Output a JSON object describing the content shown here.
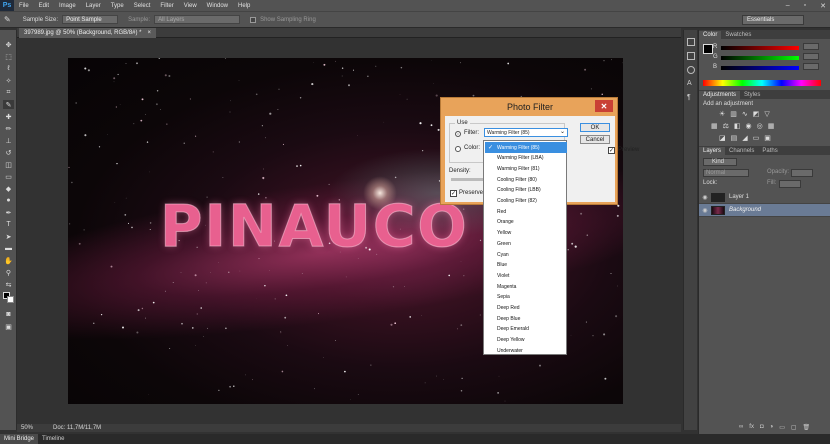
{
  "app": {
    "logo": "Ps"
  },
  "menubar": {
    "items": [
      "File",
      "Edit",
      "Image",
      "Layer",
      "Type",
      "Select",
      "Filter",
      "View",
      "Window",
      "Help"
    ]
  },
  "options": {
    "tool_icon": "eyedropper-icon",
    "sample_size_label": "Sample Size:",
    "sample_size_value": "Point Sample",
    "sample_label": "Sample:",
    "sample_value": "All Layers",
    "show_ring_label": "Show Sampling Ring",
    "workspace": "Essentials"
  },
  "document": {
    "tab_label": "397989.jpg @ 50% (Background, RGB/8#) *"
  },
  "canvas": {
    "text": "PINAUCO"
  },
  "status": {
    "zoom": "50%",
    "doc": "Doc: 11,7M/11,7M"
  },
  "bottom_tabs": [
    "Mini Bridge",
    "Timeline"
  ],
  "color_panel": {
    "tabs": [
      "Color",
      "Swatches"
    ],
    "channels": [
      "R",
      "G",
      "B"
    ]
  },
  "adjustments_panel": {
    "tabs": [
      "Adjustments",
      "Styles"
    ],
    "heading": "Add an adjustment"
  },
  "layers_panel": {
    "tabs": [
      "Layers",
      "Channels",
      "Paths"
    ],
    "kind": "Kind",
    "blend_mode": "Normal",
    "opacity_label": "Opacity:",
    "lock_label": "Lock:",
    "fill_label": "Fill:",
    "layers": [
      {
        "name": "Layer 1"
      },
      {
        "name": "Background"
      }
    ]
  },
  "dialog": {
    "title": "Photo Filter",
    "close": "✕",
    "use_label": "Use",
    "filter_label": "Filter:",
    "filter_value": "Warming Filter (85)",
    "color_label": "Color:",
    "ok": "OK",
    "cancel": "Cancel",
    "preview_label": "Preview",
    "density_label": "Density:",
    "preserve_label": "Preserve L"
  },
  "dropdown": {
    "selected": "Warming Filter (85)",
    "items": [
      "Warming Filter (85)",
      "Warming Filter (LBA)",
      "Warming Filter (81)",
      "Cooling Filter (80)",
      "Cooling Filter (LBB)",
      "Cooling Filter (82)",
      "Red",
      "Orange",
      "Yellow",
      "Green",
      "Cyan",
      "Blue",
      "Violet",
      "Magenta",
      "Sepia",
      "Deep Red",
      "Deep Blue",
      "Deep Emerald",
      "Deep Yellow",
      "Underwater"
    ]
  },
  "colors": {
    "accent": "#3a8fe0",
    "dialog_frame": "#e8a35a",
    "close": "#c94035"
  }
}
